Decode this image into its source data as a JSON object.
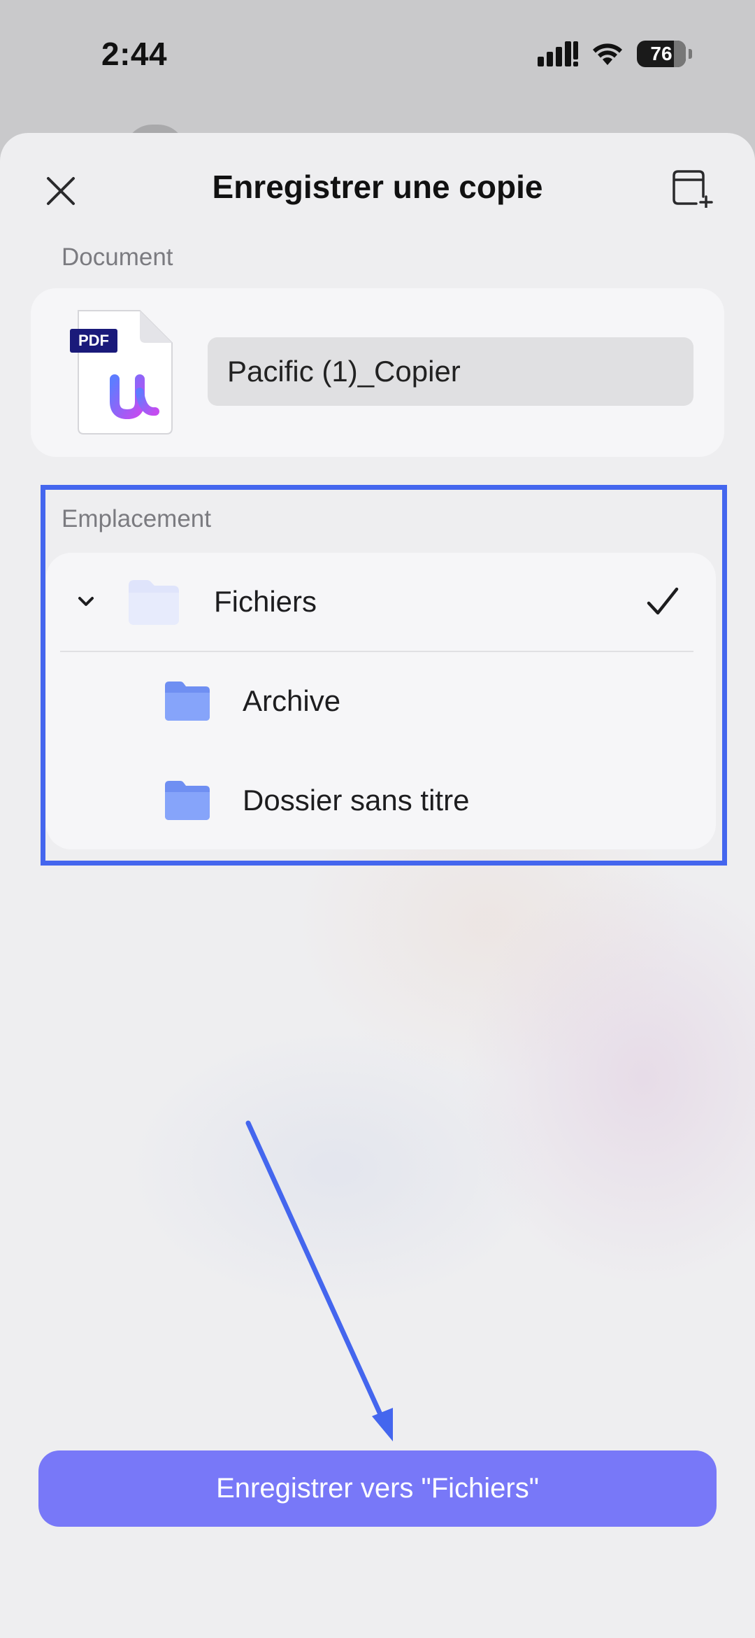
{
  "status_bar": {
    "time": "2:44",
    "battery_level": "76",
    "icons": [
      "signal-icon",
      "wifi-icon",
      "battery-icon"
    ]
  },
  "sheet": {
    "title": "Enregistrer une copie",
    "close_icon": "close-icon",
    "new_window_icon": "new-window-plus-icon"
  },
  "document": {
    "section_label": "Document",
    "file_badge": "PDF",
    "file_name": "Pacific (1)_Copier"
  },
  "location": {
    "section_label": "Emplacement",
    "root": {
      "label": "Fichiers",
      "expanded": true,
      "selected": true
    },
    "folders": [
      {
        "label": "Archive"
      },
      {
        "label": "Dossier sans titre"
      }
    ]
  },
  "save_button": {
    "label": "Enregistrer vers \"Fichiers\""
  },
  "colors": {
    "accent": "#7878f8",
    "highlight": "#4466ee",
    "folder": "#7b9cf6",
    "root_folder": "#dfe4fb"
  }
}
